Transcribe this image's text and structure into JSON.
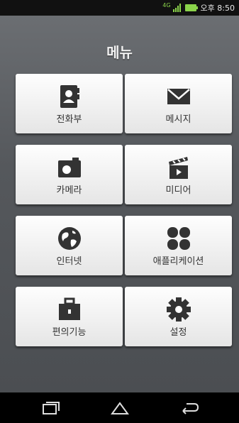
{
  "status_bar": {
    "network": "4G",
    "time": "오후 8:50",
    "icons": [
      "signal-icon",
      "battery-icon"
    ],
    "accent_color": "#8ad34a"
  },
  "header": {
    "title": "메뉴"
  },
  "menu": {
    "items": [
      {
        "label": "전화부",
        "icon": "contacts-icon"
      },
      {
        "label": "메시지",
        "icon": "envelope-icon"
      },
      {
        "label": "카메라",
        "icon": "camera-icon"
      },
      {
        "label": "미디어",
        "icon": "clapperboard-icon"
      },
      {
        "label": "인터넷",
        "icon": "globe-icon"
      },
      {
        "label": "애플리케이션",
        "icon": "apps-icon"
      },
      {
        "label": "편의기능",
        "icon": "toolbox-icon"
      },
      {
        "label": "설정",
        "icon": "gear-icon"
      }
    ]
  },
  "nav_bar": {
    "icons": [
      "recent-apps-icon",
      "home-icon",
      "back-icon"
    ]
  }
}
